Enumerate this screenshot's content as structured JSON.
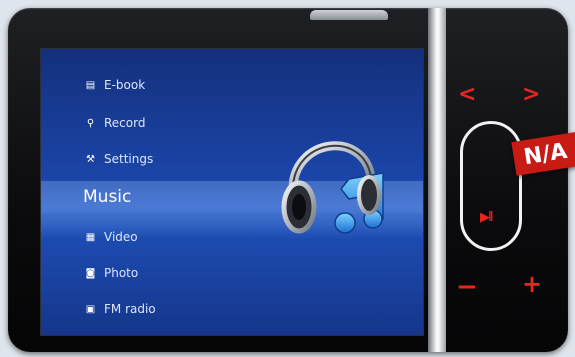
{
  "menu": {
    "items": [
      {
        "label": "E-book",
        "icon": "book-icon"
      },
      {
        "label": "Record",
        "icon": "microphone-icon"
      },
      {
        "label": "Settings",
        "icon": "wrench-icon"
      },
      {
        "label": "Music",
        "icon": "music-icon"
      },
      {
        "label": "Video",
        "icon": "film-icon"
      },
      {
        "label": "Photo",
        "icon": "camera-icon"
      },
      {
        "label": "FM radio",
        "icon": "radio-icon"
      }
    ],
    "selected_label": "Music"
  },
  "controls": {
    "prev": "<",
    "next": ">",
    "minus": "−",
    "plus": "+",
    "play_pause": "▶II"
  },
  "badge": {
    "text": "N/A"
  },
  "colors": {
    "accent_red": "#e8261c",
    "screen_blue": "#1e4fb8",
    "badge_red": "#c71b14"
  }
}
